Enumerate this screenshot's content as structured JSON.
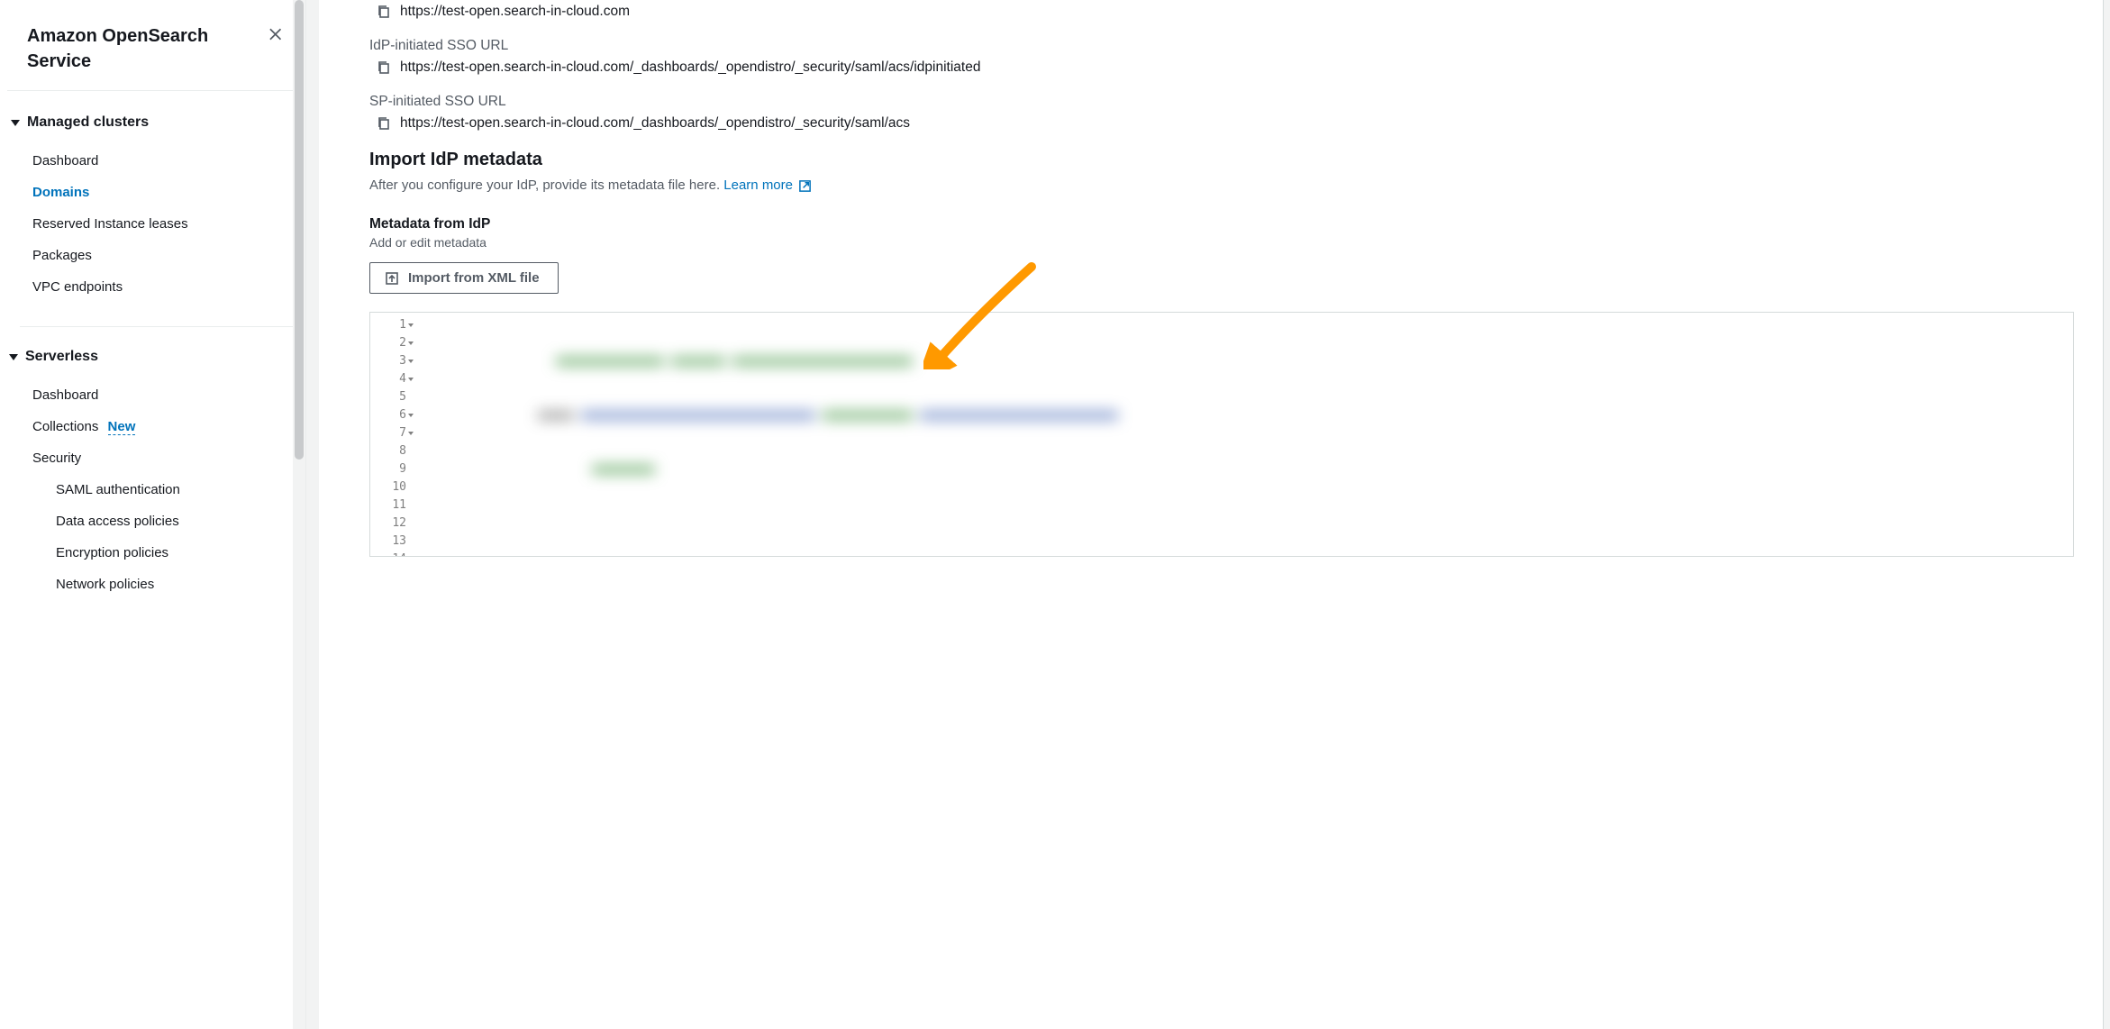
{
  "sidebar": {
    "serviceTitle": "Amazon OpenSearch Service",
    "sections": [
      {
        "label": "Managed clusters",
        "items": [
          {
            "label": "Dashboard",
            "active": false
          },
          {
            "label": "Domains",
            "active": true
          },
          {
            "label": "Reserved Instance leases",
            "active": false
          },
          {
            "label": "Packages",
            "active": false
          },
          {
            "label": "VPC endpoints",
            "active": false
          }
        ]
      },
      {
        "label": "Serverless",
        "items": [
          {
            "label": "Dashboard",
            "active": false
          },
          {
            "label": "Collections",
            "active": false,
            "badge": "New"
          },
          {
            "label": "Security",
            "active": false,
            "subitems": [
              {
                "label": "SAML authentication"
              },
              {
                "label": "Data access policies"
              },
              {
                "label": "Encryption policies"
              },
              {
                "label": "Network policies"
              }
            ]
          }
        ]
      }
    ]
  },
  "main": {
    "urls": [
      {
        "label": "",
        "value": "https://test-open.search-in-cloud.com"
      },
      {
        "label": "IdP-initiated SSO URL",
        "value": "https://test-open.search-in-cloud.com/_dashboards/_opendistro/_security/saml/acs/idpinitiated"
      },
      {
        "label": "SP-initiated SSO URL",
        "value": "https://test-open.search-in-cloud.com/_dashboards/_opendistro/_security/saml/acs"
      }
    ],
    "importSection": {
      "heading": "Import IdP metadata",
      "description": "After you configure your IdP, provide its metadata file here. ",
      "learnMoreText": "Learn more",
      "metadataLabel": "Metadata from IdP",
      "metadataDesc": "Add or edit metadata",
      "importButtonLabel": "Import from XML file",
      "lineCount": 14,
      "foldableLines": [
        1,
        2,
        3,
        4,
        6,
        7
      ]
    }
  }
}
